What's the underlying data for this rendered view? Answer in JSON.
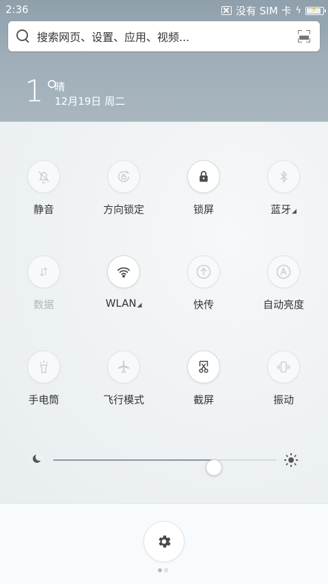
{
  "status_bar": {
    "time": "2:36",
    "sim_text": "没有 SIM 卡"
  },
  "search": {
    "placeholder": "搜索网页、设置、应用、视频..."
  },
  "weather": {
    "temperature": "1°",
    "condition": "晴",
    "date": "12月19日 周二"
  },
  "toggles": [
    {
      "label": "静音",
      "icon": "bell-off-icon",
      "active": false
    },
    {
      "label": "方向锁定",
      "icon": "rotation-lock-icon",
      "active": false
    },
    {
      "label": "锁屏",
      "icon": "lock-icon",
      "active": true
    },
    {
      "label": "蓝牙",
      "icon": "bluetooth-icon",
      "active": false,
      "has_menu": true
    },
    {
      "label": "数据",
      "icon": "mobile-data-icon",
      "active": false,
      "disabled": true
    },
    {
      "label": "WLAN",
      "icon": "wifi-icon",
      "active": true,
      "has_menu": true
    },
    {
      "label": "快传",
      "icon": "quick-transfer-icon",
      "active": false
    },
    {
      "label": "自动亮度",
      "icon": "auto-brightness-icon",
      "active": false
    },
    {
      "label": "手电筒",
      "icon": "flashlight-icon",
      "active": false
    },
    {
      "label": "飞行模式",
      "icon": "airplane-icon",
      "active": false
    },
    {
      "label": "截屏",
      "icon": "screenshot-icon",
      "active": true
    },
    {
      "label": "振动",
      "icon": "vibrate-icon",
      "active": false
    }
  ],
  "brightness": {
    "level": 0.72
  },
  "footer": {
    "settings_icon": "gear-icon",
    "page_count": 2,
    "current_page": 1
  }
}
